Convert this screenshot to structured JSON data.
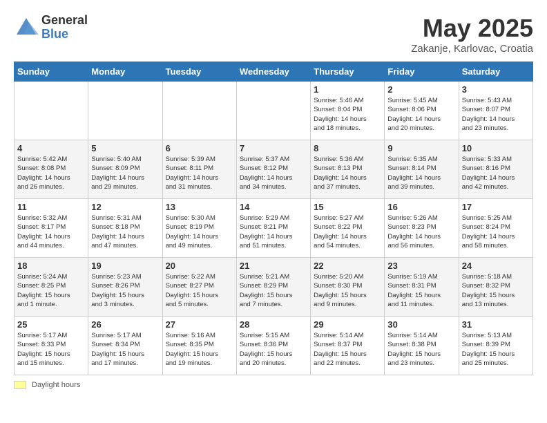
{
  "logo": {
    "general": "General",
    "blue": "Blue"
  },
  "title": "May 2025",
  "subtitle": "Zakanje, Karlovac, Croatia",
  "days": [
    "Sunday",
    "Monday",
    "Tuesday",
    "Wednesday",
    "Thursday",
    "Friday",
    "Saturday"
  ],
  "weeks": [
    [
      {
        "day": "",
        "info": ""
      },
      {
        "day": "",
        "info": ""
      },
      {
        "day": "",
        "info": ""
      },
      {
        "day": "",
        "info": ""
      },
      {
        "day": "1",
        "info": "Sunrise: 5:46 AM\nSunset: 8:04 PM\nDaylight: 14 hours\nand 18 minutes."
      },
      {
        "day": "2",
        "info": "Sunrise: 5:45 AM\nSunset: 8:06 PM\nDaylight: 14 hours\nand 20 minutes."
      },
      {
        "day": "3",
        "info": "Sunrise: 5:43 AM\nSunset: 8:07 PM\nDaylight: 14 hours\nand 23 minutes."
      }
    ],
    [
      {
        "day": "4",
        "info": "Sunrise: 5:42 AM\nSunset: 8:08 PM\nDaylight: 14 hours\nand 26 minutes."
      },
      {
        "day": "5",
        "info": "Sunrise: 5:40 AM\nSunset: 8:09 PM\nDaylight: 14 hours\nand 29 minutes."
      },
      {
        "day": "6",
        "info": "Sunrise: 5:39 AM\nSunset: 8:11 PM\nDaylight: 14 hours\nand 31 minutes."
      },
      {
        "day": "7",
        "info": "Sunrise: 5:37 AM\nSunset: 8:12 PM\nDaylight: 14 hours\nand 34 minutes."
      },
      {
        "day": "8",
        "info": "Sunrise: 5:36 AM\nSunset: 8:13 PM\nDaylight: 14 hours\nand 37 minutes."
      },
      {
        "day": "9",
        "info": "Sunrise: 5:35 AM\nSunset: 8:14 PM\nDaylight: 14 hours\nand 39 minutes."
      },
      {
        "day": "10",
        "info": "Sunrise: 5:33 AM\nSunset: 8:16 PM\nDaylight: 14 hours\nand 42 minutes."
      }
    ],
    [
      {
        "day": "11",
        "info": "Sunrise: 5:32 AM\nSunset: 8:17 PM\nDaylight: 14 hours\nand 44 minutes."
      },
      {
        "day": "12",
        "info": "Sunrise: 5:31 AM\nSunset: 8:18 PM\nDaylight: 14 hours\nand 47 minutes."
      },
      {
        "day": "13",
        "info": "Sunrise: 5:30 AM\nSunset: 8:19 PM\nDaylight: 14 hours\nand 49 minutes."
      },
      {
        "day": "14",
        "info": "Sunrise: 5:29 AM\nSunset: 8:21 PM\nDaylight: 14 hours\nand 51 minutes."
      },
      {
        "day": "15",
        "info": "Sunrise: 5:27 AM\nSunset: 8:22 PM\nDaylight: 14 hours\nand 54 minutes."
      },
      {
        "day": "16",
        "info": "Sunrise: 5:26 AM\nSunset: 8:23 PM\nDaylight: 14 hours\nand 56 minutes."
      },
      {
        "day": "17",
        "info": "Sunrise: 5:25 AM\nSunset: 8:24 PM\nDaylight: 14 hours\nand 58 minutes."
      }
    ],
    [
      {
        "day": "18",
        "info": "Sunrise: 5:24 AM\nSunset: 8:25 PM\nDaylight: 15 hours\nand 1 minute."
      },
      {
        "day": "19",
        "info": "Sunrise: 5:23 AM\nSunset: 8:26 PM\nDaylight: 15 hours\nand 3 minutes."
      },
      {
        "day": "20",
        "info": "Sunrise: 5:22 AM\nSunset: 8:27 PM\nDaylight: 15 hours\nand 5 minutes."
      },
      {
        "day": "21",
        "info": "Sunrise: 5:21 AM\nSunset: 8:29 PM\nDaylight: 15 hours\nand 7 minutes."
      },
      {
        "day": "22",
        "info": "Sunrise: 5:20 AM\nSunset: 8:30 PM\nDaylight: 15 hours\nand 9 minutes."
      },
      {
        "day": "23",
        "info": "Sunrise: 5:19 AM\nSunset: 8:31 PM\nDaylight: 15 hours\nand 11 minutes."
      },
      {
        "day": "24",
        "info": "Sunrise: 5:18 AM\nSunset: 8:32 PM\nDaylight: 15 hours\nand 13 minutes."
      }
    ],
    [
      {
        "day": "25",
        "info": "Sunrise: 5:17 AM\nSunset: 8:33 PM\nDaylight: 15 hours\nand 15 minutes."
      },
      {
        "day": "26",
        "info": "Sunrise: 5:17 AM\nSunset: 8:34 PM\nDaylight: 15 hours\nand 17 minutes."
      },
      {
        "day": "27",
        "info": "Sunrise: 5:16 AM\nSunset: 8:35 PM\nDaylight: 15 hours\nand 19 minutes."
      },
      {
        "day": "28",
        "info": "Sunrise: 5:15 AM\nSunset: 8:36 PM\nDaylight: 15 hours\nand 20 minutes."
      },
      {
        "day": "29",
        "info": "Sunrise: 5:14 AM\nSunset: 8:37 PM\nDaylight: 15 hours\nand 22 minutes."
      },
      {
        "day": "30",
        "info": "Sunrise: 5:14 AM\nSunset: 8:38 PM\nDaylight: 15 hours\nand 23 minutes."
      },
      {
        "day": "31",
        "info": "Sunrise: 5:13 AM\nSunset: 8:39 PM\nDaylight: 15 hours\nand 25 minutes."
      }
    ]
  ],
  "footer": {
    "legend_label": "Daylight hours"
  }
}
